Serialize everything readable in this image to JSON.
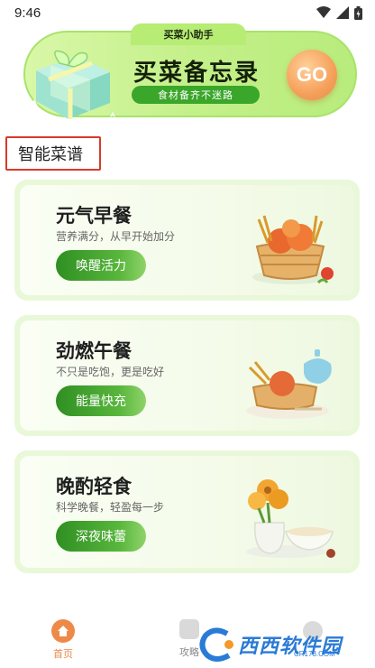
{
  "status_bar": {
    "time": "9:46"
  },
  "banner": {
    "tab_label": "买菜小助手",
    "title": "买菜备忘录",
    "subtitle": "食材备齐不迷路",
    "go_label": "GO"
  },
  "section": {
    "title": "智能菜谱"
  },
  "cards": [
    {
      "title": "元气早餐",
      "subtitle": "营养满分，从早开始加分",
      "button": "唤醒活力"
    },
    {
      "title": "劲燃午餐",
      "subtitle": "不只是吃饱，更是吃好",
      "button": "能量快充"
    },
    {
      "title": "晚酌轻食",
      "subtitle": "科学晚餐，轻盈每一步",
      "button": "深夜味蕾"
    }
  ],
  "nav": {
    "home_label": "首页",
    "strategy_label": "攻略"
  },
  "watermark": {
    "text": "西西软件园",
    "sub": "CR173.COM"
  },
  "colors": {
    "accent_green": "#3aa62a",
    "go_orange": "#f5a05a",
    "highlight_red": "#d93a2b"
  }
}
